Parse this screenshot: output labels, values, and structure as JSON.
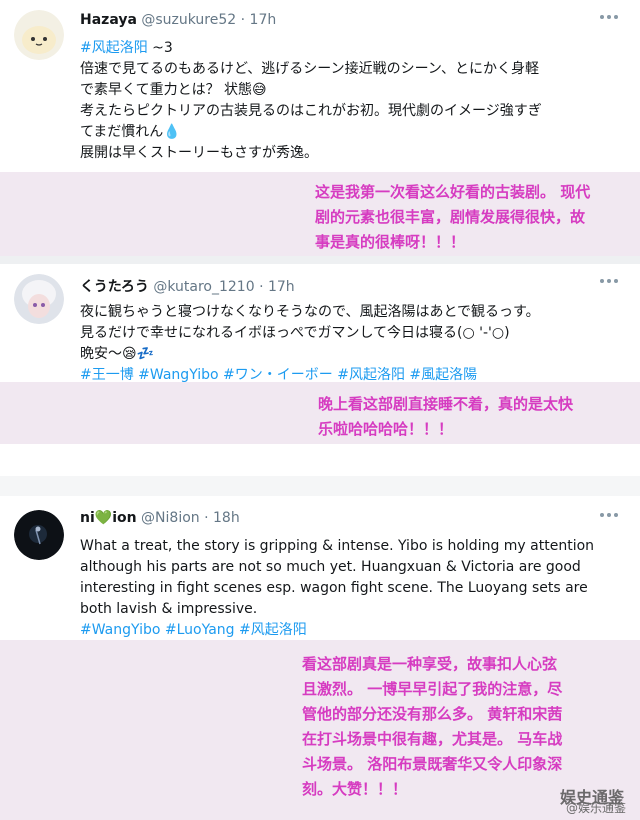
{
  "tweets": [
    {
      "name": "Hazaya",
      "handle": "@suzukure52",
      "time": "17h",
      "lines": [
        {
          "tag": "#风起洛阳",
          "rest": " ~3"
        },
        {
          "text": "倍速で見てるのもあるけど、逃げるシーン接近戦のシーン、とにかく身軽"
        },
        {
          "text": "で素早くて重力とは？ 状態😅"
        },
        {
          "text": "考えたらピクトリアの古装見るのはこれがお初。現代劇のイメージ強すぎ"
        },
        {
          "text": "てまだ慣れん💧"
        },
        {
          "text": "展開は早くストーリーもさすが秀逸。"
        }
      ],
      "translation": [
        "这是我第一次看这么好看的古装剧。 现代",
        "剧的元素也很丰富，剧情发展得很快，故",
        "事是真的很棒呀！！！"
      ]
    },
    {
      "name": "くうたろう",
      "handle": "@kutaro_1210",
      "time": "17h",
      "lines": [
        {
          "text": "夜に観ちゃうと寝つけなくなりそうなので、風起洛陽はあとで観るっす。"
        },
        {
          "text": "見るだけで幸せになれるイボほっぺでガマンして今日は寝る(○ '-'○)"
        },
        {
          "text": "晩安～😪💤"
        }
      ],
      "hashtags": "#王一博 #WangYibo #ワン・イーボー #风起洛阳 #風起洛陽",
      "translation": [
        "晚上看这部剧直接睡不着，真的是太快",
        "乐啦哈哈哈哈！！！"
      ]
    },
    {
      "name": "ni💚ion",
      "handle": "@Ni8ion",
      "time": "18h",
      "lines": [
        {
          "text": "What a treat, the story is gripping & intense. Yibo is holding my attention"
        },
        {
          "text": "although his parts are not so much yet. Huangxuan & Victoria are good"
        },
        {
          "text": "interesting in fight scenes esp. wagon fight scene. The  Luoyang sets are"
        },
        {
          "text": "both lavish & impressive."
        }
      ],
      "hashtags": "#WangYibo #LuoYang #风起洛阳",
      "translation": [
        "看这部剧真是一种享受，故事扣人心弦",
        "且激烈。 一博早早引起了我的注意，尽",
        "管他的部分还没有那么多。 黄轩和宋茜",
        "在打斗场景中很有趣，尤其是。 马车战",
        "斗场景。 洛阳布景既奢华又令人印象深",
        "刻。大赞！！！"
      ]
    }
  ],
  "watermark": "娱史通鉴",
  "watermark_sub": "@娱乐通鉴",
  "colors": {
    "hashtag": "#1d9bf0",
    "translation_text": "#d63cc1",
    "translation_bg": "#f1e8f1"
  }
}
